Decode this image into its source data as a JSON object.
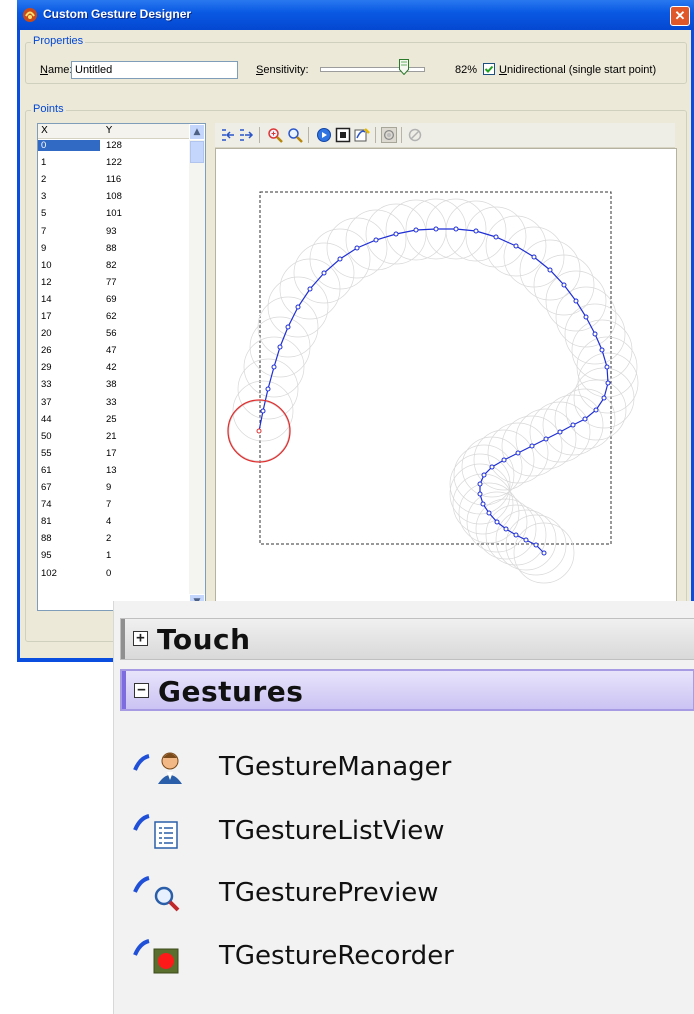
{
  "window": {
    "title": "Custom Gesture Designer",
    "close_glyph": "✕"
  },
  "properties": {
    "legend": "Properties",
    "name_label_accel": "N",
    "name_label_rest": "ame:",
    "name_value": "Untitled",
    "sensitivity_label_accel": "S",
    "sensitivity_label_rest": "ensitivity:",
    "sensitivity_value": "82%",
    "sensitivity_level": 0.82,
    "unidirectional_checked": true,
    "unidirectional_label_accel": "U",
    "unidirectional_label_rest": "nidirectional (single start point)"
  },
  "points": {
    "legend": "Points",
    "columns": [
      "X",
      "Y"
    ],
    "rows": [
      [
        "0",
        "128"
      ],
      [
        "1",
        "122"
      ],
      [
        "2",
        "116"
      ],
      [
        "3",
        "108"
      ],
      [
        "5",
        "101"
      ],
      [
        "7",
        "93"
      ],
      [
        "9",
        "88"
      ],
      [
        "10",
        "82"
      ],
      [
        "12",
        "77"
      ],
      [
        "14",
        "69"
      ],
      [
        "17",
        "62"
      ],
      [
        "20",
        "56"
      ],
      [
        "26",
        "47"
      ],
      [
        "29",
        "42"
      ],
      [
        "33",
        "38"
      ],
      [
        "37",
        "33"
      ],
      [
        "44",
        "25"
      ],
      [
        "50",
        "21"
      ],
      [
        "55",
        "17"
      ],
      [
        "61",
        "13"
      ],
      [
        "67",
        "9"
      ],
      [
        "74",
        "7"
      ],
      [
        "81",
        "4"
      ],
      [
        "88",
        "2"
      ],
      [
        "95",
        "1"
      ],
      [
        "102",
        "0"
      ]
    ],
    "selected_row": 0
  },
  "toolbar": {
    "icons": [
      "indent-left-icon",
      "indent-right-icon",
      "zoom-in-icon",
      "zoom-out-icon",
      "play-icon",
      "stop-icon",
      "record-icon",
      "toggle-icon",
      "clear-icon"
    ]
  },
  "colors": {
    "gesture_line": "#1f2fd6",
    "start_circle": "#e03030",
    "ghost": "#d8d8d8",
    "selection": "#316ac5",
    "active_category": "#cbc3f3"
  },
  "palette": {
    "categories": [
      {
        "label": "Touch",
        "expander": "+",
        "expanded": false
      },
      {
        "label": "Gestures",
        "expander": "−",
        "expanded": true
      }
    ],
    "components": [
      {
        "label": "TGestureManager",
        "icon": "gesture-manager-icon"
      },
      {
        "label": "TGestureListView",
        "icon": "gesture-list-view-icon"
      },
      {
        "label": "TGesturePreview",
        "icon": "gesture-preview-icon"
      },
      {
        "label": "TGestureRecorder",
        "icon": "gesture-recorder-icon"
      }
    ]
  }
}
